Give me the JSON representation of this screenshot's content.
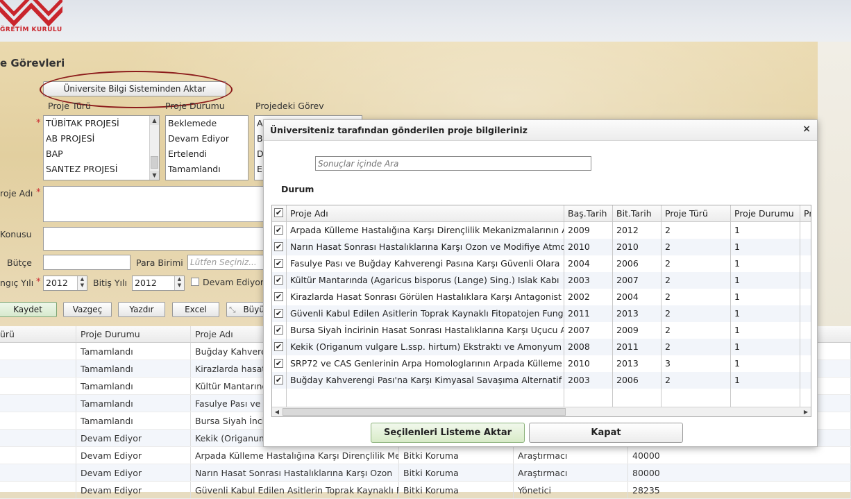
{
  "brand": {
    "logo_text": "ĞRETİM KURULU"
  },
  "page": {
    "title": "e Görevleri"
  },
  "actions": {
    "import_button": "Üniversite Bilgi Sisteminden Aktar"
  },
  "form": {
    "labels": {
      "proje_turu": "Proje Türü",
      "proje_durumu": "Proje Durumu",
      "projedeki_gorev": "Projedeki Görev",
      "proje_adi": "roje Adı",
      "konusu": "Konusu",
      "butce": "Bütçe",
      "para_birimi": "Para Birimi",
      "baslangic_yili": "ngıç Yılı",
      "bitis_yili": "Bitiş Yılı",
      "devam_ediyor": "Devam Ediyor"
    },
    "required_mark": "*",
    "proje_turu_options": [
      "TÜBİTAK PROJESİ",
      "AB PROJESİ",
      "BAP",
      "SANTEZ PROJESİ"
    ],
    "proje_durumu_options": [
      "Beklemede",
      "Devam Ediyor",
      "Ertelendi",
      "Tamamlandı"
    ],
    "gorev_options": [
      "A",
      "B",
      "D",
      "E"
    ],
    "para_birimi_placeholder": "Lütfen Seçiniz...",
    "baslangic_yili_value": "2012",
    "bitis_yili_value": "2012"
  },
  "toolbar": {
    "kaydet": "Kaydet",
    "vazgec": "Vazgeç",
    "yazdir": "Yazdır",
    "excel": "Excel",
    "buyut": "Büyü"
  },
  "bg_table": {
    "headers": [
      "ürü",
      "Proje Durumu",
      "Proje Adı"
    ],
    "rows": [
      {
        "durum": "Tamamlandı",
        "adi": "Buğday Kahverengi",
        "alan": "",
        "gorev": "",
        "butce": ""
      },
      {
        "durum": "Tamamlandı",
        "adi": "Kirazlarda hasat",
        "alan": "",
        "gorev": "",
        "butce": ""
      },
      {
        "durum": "Tamamlandı",
        "adi": "Kültür Mantarında",
        "alan": "",
        "gorev": "",
        "butce": ""
      },
      {
        "durum": "Tamamlandı",
        "adi": "Fasulye Pası ve",
        "alan": "",
        "gorev": "",
        "butce": ""
      },
      {
        "durum": "Tamamlandı",
        "adi": "Bursa Siyah İnciri",
        "alan": "",
        "gorev": "",
        "butce": ""
      },
      {
        "durum": "Devam Ediyor",
        "adi": "Kekik (Origanum",
        "alan": "",
        "gorev": "",
        "butce": ""
      },
      {
        "durum": "Devam Ediyor",
        "adi": "Arpada Külleme Hastalığına Karşı Dirençlilik Me",
        "alan": "Bitki Koruma",
        "gorev": "Araştırmacı",
        "butce": "40000"
      },
      {
        "durum": "Devam Ediyor",
        "adi": "Narın Hasat Sonrası Hastalıklarına Karşı Ozon",
        "alan": "Bitki Koruma",
        "gorev": "Araştırmacı",
        "butce": "80000"
      },
      {
        "durum": "Devam Ediyor",
        "adi": "Güvenli Kabul Edilen Asitlerin Toprak Kaynaklı F",
        "alan": "Bitki Koruma",
        "gorev": "Yönetici",
        "butce": "28235"
      }
    ]
  },
  "modal": {
    "title": "Üniversiteniz tarafından gönderilen proje bilgileriniz",
    "close": "×",
    "search_placeholder": "Sonuçlar içinde Ara",
    "durum_label": "Durum",
    "columns": [
      "Proje Adı",
      "Baş.Tarih",
      "Bit.Tarih",
      "Proje Türü",
      "Proje Durumu",
      "Pr"
    ],
    "rows": [
      {
        "checked": true,
        "adi": "Arpada Külleme Hastalığına Karşı Dirençlilik Mekanizmalarının A",
        "bas": "2009",
        "bit": "2012",
        "tur": "2",
        "durum": "1"
      },
      {
        "checked": true,
        "adi": "Narın Hasat Sonrası Hastalıklarına Karşı Ozon ve Modifiye Atmo",
        "bas": "2010",
        "bit": "2010",
        "tur": "2",
        "durum": "1"
      },
      {
        "checked": true,
        "adi": "Fasulye Pası ve Buğday Kahverengi Pasına Karşı Güvenli Olara",
        "bas": "2004",
        "bit": "2006",
        "tur": "2",
        "durum": "1"
      },
      {
        "checked": true,
        "adi": "Kültür Mantarında (Agaricus bisporus (Lange) Sing.) Islak Kabı",
        "bas": "2003",
        "bit": "2007",
        "tur": "2",
        "durum": "1"
      },
      {
        "checked": true,
        "adi": "Kirazlarda Hasat Sonrası Görülen Hastalıklara Karşı Antagonist",
        "bas": "2002",
        "bit": "2004",
        "tur": "2",
        "durum": "1"
      },
      {
        "checked": true,
        "adi": "Güvenli Kabul Edilen Asitlerin Toprak Kaynaklı Fitopatojen Fung",
        "bas": "2011",
        "bit": "2013",
        "tur": "2",
        "durum": "1"
      },
      {
        "checked": true,
        "adi": "Bursa Siyah İncirinin Hasat Sonrası Hastalıklarına Karşı Uçucu A",
        "bas": "2007",
        "bit": "2009",
        "tur": "2",
        "durum": "1"
      },
      {
        "checked": true,
        "adi": "Kekik (Origanum vulgare L.ssp. hirtum) Ekstraktı ve Amonyum",
        "bas": "2008",
        "bit": "2011",
        "tur": "2",
        "durum": "1"
      },
      {
        "checked": true,
        "adi": "SRP72 ve CAS Genlerinin Arpa Homologlarının Arpada Külleme",
        "bas": "2010",
        "bit": "2013",
        "tur": "3",
        "durum": "1"
      },
      {
        "checked": true,
        "adi": "Buğday Kahverengi Pası'na Karşı Kimyasal Savaşıma Alternatif",
        "bas": "2003",
        "bit": "2006",
        "tur": "2",
        "durum": "1"
      }
    ],
    "transfer_button": "Seçilenleri Listeme Aktar",
    "close_button": "Kapat"
  },
  "icons": {
    "check": "✔",
    "scroll_up": "▲",
    "scroll_down": "▼",
    "scroll_left": "◀",
    "scroll_right": "▶",
    "dropdown": "▼"
  },
  "colors": {
    "brand_red": "#c9252c",
    "annotation_circle": "#8c1b1b",
    "primary_button": "#d8ebc8"
  }
}
